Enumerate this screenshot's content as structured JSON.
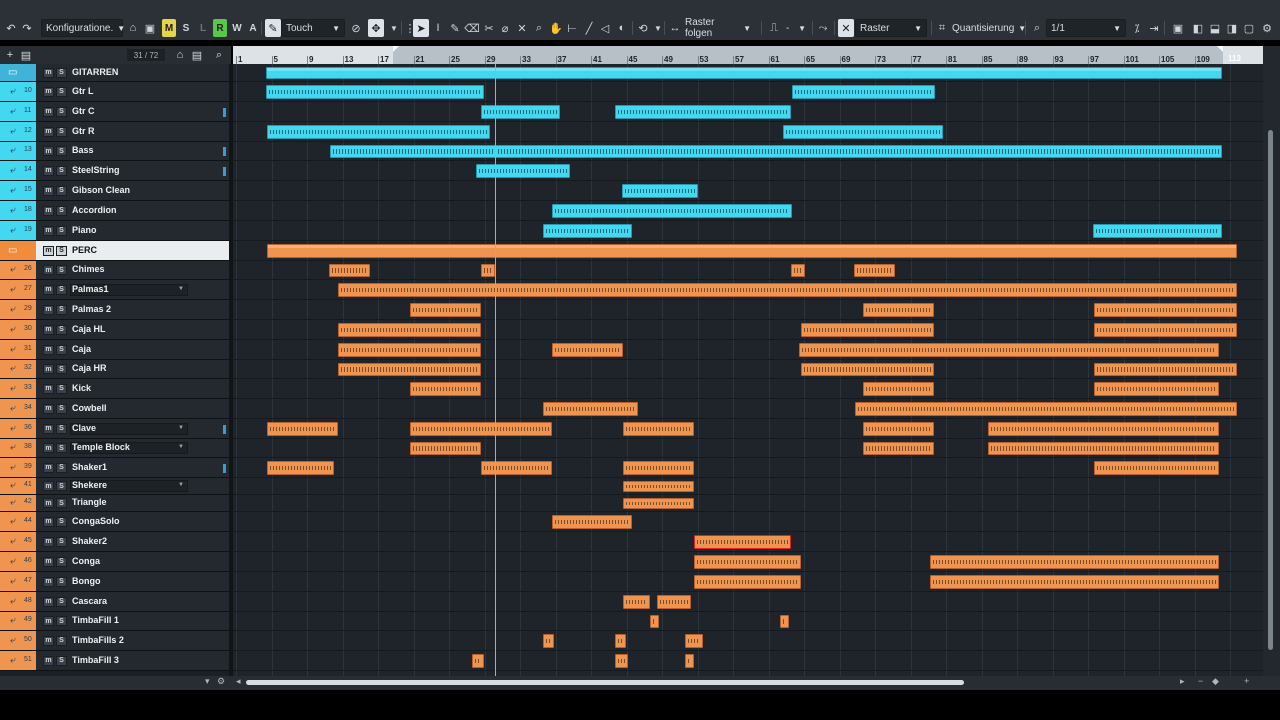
{
  "toolbar": {
    "undo_icon": "undo-icon",
    "redo_icon": "redo-icon",
    "config_label": "Konfiguratione.",
    "m_label": "M",
    "s_label": "S",
    "l_label": "L",
    "r_label": "R",
    "w_label": "W",
    "a_label": "A",
    "automation_mode": "Touch",
    "snap_mode": "Raster folgen",
    "line_label": "-",
    "grid_type": "Raster",
    "quantize_label": "Quantisierung",
    "quantize_value": "1/1"
  },
  "tracklist_header": {
    "count": "31 / 72"
  },
  "ruler": {
    "labels": [
      "1",
      "5",
      "9",
      "13",
      "17",
      "21",
      "25",
      "29",
      "33",
      "37",
      "41",
      "45",
      "49",
      "53",
      "57",
      "61",
      "65",
      "69",
      "73",
      "77",
      "81",
      "85",
      "89",
      "93",
      "97",
      "101",
      "105",
      "109"
    ],
    "end_label": "113"
  },
  "colors": {
    "guitar": "#42d8f0",
    "guitar_folder": "#3fb4d8",
    "perc": "#f0954f",
    "perc_folder": "#f08c3c"
  },
  "tracks": [
    {
      "num": "",
      "name": "GITARREN",
      "type": "folder",
      "group": "g"
    },
    {
      "num": "10",
      "name": "Gtr L",
      "type": "audio",
      "group": "g"
    },
    {
      "num": "11",
      "name": "Gtr C",
      "type": "audio",
      "group": "g"
    },
    {
      "num": "12",
      "name": "Gtr R",
      "type": "audio",
      "group": "g"
    },
    {
      "num": "13",
      "name": "Bass",
      "type": "audio",
      "group": "g"
    },
    {
      "num": "14",
      "name": "SteelString",
      "type": "audio",
      "group": "g"
    },
    {
      "num": "15",
      "name": "Gibson Clean",
      "type": "audio",
      "group": "g"
    },
    {
      "num": "18",
      "name": "Accordion",
      "type": "audio",
      "group": "g"
    },
    {
      "num": "19",
      "name": "Piano",
      "type": "audio",
      "group": "g"
    },
    {
      "num": "",
      "name": "PERC",
      "type": "folder",
      "group": "p",
      "selected": true
    },
    {
      "num": "26",
      "name": "Chimes",
      "type": "audio",
      "group": "p"
    },
    {
      "num": "27",
      "name": "Palmas1",
      "type": "audio",
      "group": "p"
    },
    {
      "num": "29",
      "name": "Palmas 2",
      "type": "audio",
      "group": "p"
    },
    {
      "num": "30",
      "name": "Caja HL",
      "type": "audio",
      "group": "p"
    },
    {
      "num": "31",
      "name": "Caja",
      "type": "audio",
      "group": "p"
    },
    {
      "num": "32",
      "name": "Caja HR",
      "type": "audio",
      "group": "p"
    },
    {
      "num": "33",
      "name": "Kick",
      "type": "audio",
      "group": "p"
    },
    {
      "num": "34",
      "name": "Cowbell",
      "type": "audio",
      "group": "p"
    },
    {
      "num": "36",
      "name": "Clave",
      "type": "audio",
      "group": "p"
    },
    {
      "num": "38",
      "name": "Temple Block",
      "type": "audio",
      "group": "p"
    },
    {
      "num": "39",
      "name": "Shaker1",
      "type": "audio",
      "group": "p"
    },
    {
      "num": "41",
      "name": "Shekere",
      "type": "audio",
      "group": "p"
    },
    {
      "num": "42",
      "name": "Triangle",
      "type": "audio",
      "group": "p"
    },
    {
      "num": "44",
      "name": "CongaSolo",
      "type": "audio",
      "group": "p"
    },
    {
      "num": "45",
      "name": "Shaker2",
      "type": "audio",
      "group": "p"
    },
    {
      "num": "46",
      "name": "Conga",
      "type": "audio",
      "group": "p"
    },
    {
      "num": "47",
      "name": "Bongo",
      "type": "audio",
      "group": "p"
    },
    {
      "num": "48",
      "name": "Cascara",
      "type": "audio",
      "group": "p"
    },
    {
      "num": "49",
      "name": "TimbaFill 1",
      "type": "audio",
      "group": "p"
    },
    {
      "num": "50",
      "name": "TimbaFills 2",
      "type": "audio",
      "group": "p"
    },
    {
      "num": "51",
      "name": "TimbaFill 3",
      "type": "audio",
      "group": "p"
    }
  ]
}
